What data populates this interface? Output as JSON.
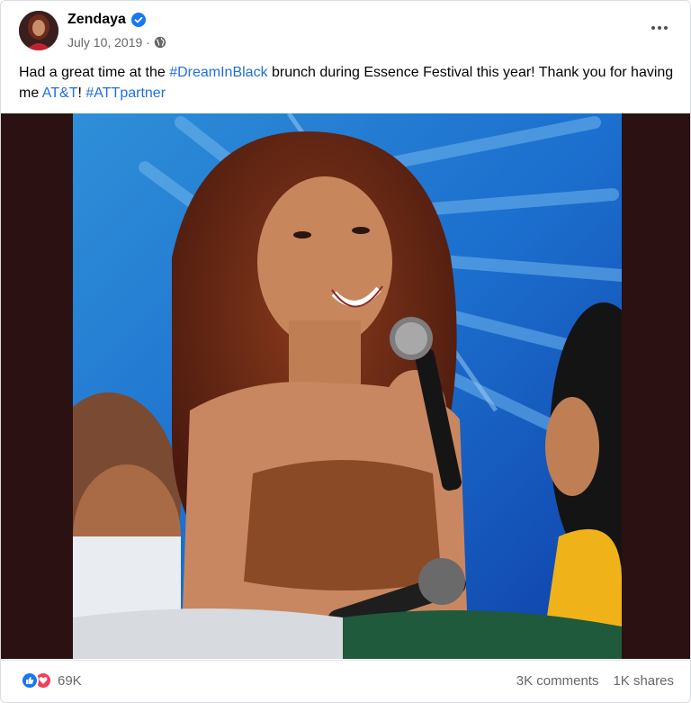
{
  "post": {
    "author": "Zendaya",
    "date": "July 10, 2019",
    "date_separator": "·",
    "text_parts": {
      "p1": "Had a great time at the ",
      "hashtag1": "#DreamInBlack",
      "p2": " brunch during Essence Festival this year! Thank you for having me ",
      "mention": "AT&T",
      "p3": "! ",
      "hashtag2": "#ATTpartner"
    }
  },
  "footer": {
    "reaction_count": "69K",
    "comments": "3K comments",
    "shares": "1K shares"
  },
  "colors": {
    "link": "#216fdb",
    "like": "#1877f2",
    "love": "#f33e58",
    "verified": "#1877f2"
  },
  "icons": {
    "verified": "verified-badge-icon",
    "audience": "globe-icon",
    "more": "more-options-icon",
    "like": "like-icon",
    "love": "love-icon"
  }
}
